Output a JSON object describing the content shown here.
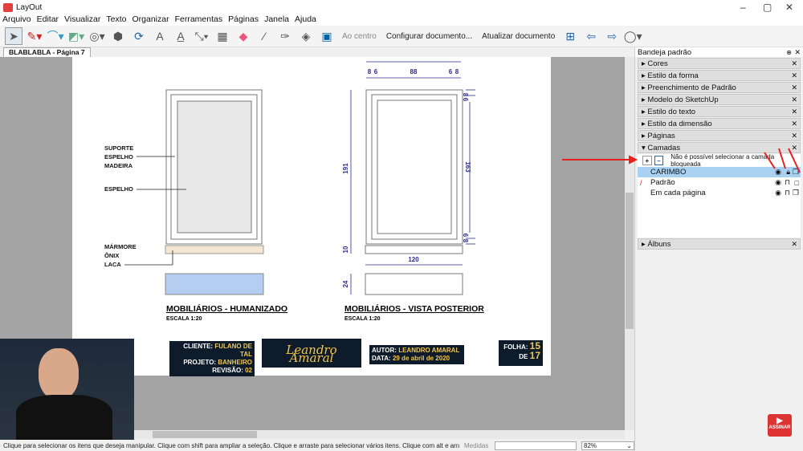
{
  "window": {
    "title": "LayOut"
  },
  "menu": [
    "Arquivo",
    "Editar",
    "Visualizar",
    "Texto",
    "Organizar",
    "Ferramentas",
    "Páginas",
    "Janela",
    "Ajuda"
  ],
  "toolbar": {
    "align": "Ao centro",
    "setup": "Configurar documento...",
    "update": "Atualizar documento"
  },
  "tab": {
    "label": "BLABLABLA - Página 7"
  },
  "drawing": {
    "left_labels": [
      "SUPORTE",
      "ESPELHO",
      "MADEIRA",
      "ESPELHO",
      "MÁRMORE",
      "ÔNIX",
      "LACA"
    ],
    "left_title": "MOBILIÁRIOS - HUMANIZADO",
    "left_scale": "ESCALA 1:20",
    "right_title": "MOBILIÁRIOS - VISTA POSTERIOR",
    "right_scale": "ESCALA 1:20",
    "dims": {
      "top_l1": "8",
      "top_l2": "6",
      "top_mid": "88",
      "top_r1": "6",
      "top_r2": "8",
      "height": "191",
      "inner": "163",
      "r_top1": "8",
      "r_top2": "6",
      "r_bot1": "6",
      "r_bot2": "8",
      "base": "10",
      "width": "120",
      "box": "24"
    }
  },
  "stamp": {
    "client_label": "CLIENTE:",
    "client": "FULANO DE TAL",
    "project_label": "PROJETO:",
    "project": "BANHEIRO",
    "rev_label": "REVISÃO:",
    "rev": "02",
    "logo": "Leandro Amaral",
    "logo_sub": "arquiteto",
    "author_label": "AUTOR:",
    "author": "LEANDRO AMARAL",
    "date_label": "DATA:",
    "date": "29 de abril de 2020",
    "sheet_label": "FOLHA:",
    "sheet": "15",
    "of_label": "DE",
    "of": "17"
  },
  "panel": {
    "title": "Bandeja padrão",
    "sections": [
      "Cores",
      "Estilo da forma",
      "Preenchimento de Padrão",
      "Modelo do SketchUp",
      "Estilo do texto",
      "Estilo da dimensão",
      "Páginas"
    ],
    "layers_title": "Camadas",
    "layers_msg": "Não é possível selecionar a camada bloqueada",
    "layers": [
      "CARIMBO",
      "Padrão",
      "Em cada página"
    ],
    "albums": "Álbuns"
  },
  "status": {
    "hint": "Clique para selecionar os itens que deseja manipular. Clique com shift para ampliar a seleção. Clique e arraste para selecionar vários itens. Clique com alt e arraste para ...",
    "measures_label": "Medidas",
    "measures_value": "",
    "zoom": "82%"
  },
  "subscribe": "ASSINAR",
  "colors": {
    "dimension": "#2b2b8c",
    "stamp_bg": "#0d1b2a",
    "stamp_text": "#f3c54a",
    "selected_layer": "#a9d2f2",
    "arrow": "#e82020"
  }
}
